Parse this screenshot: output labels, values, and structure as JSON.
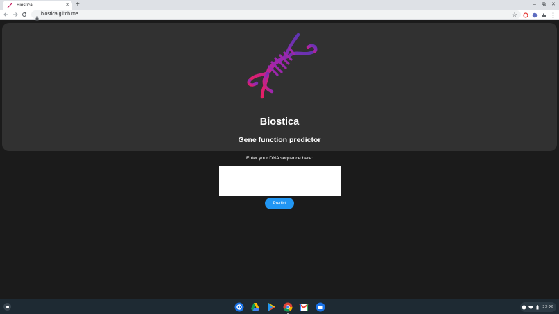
{
  "browser": {
    "tab": {
      "title": "Biostica",
      "close_glyph": "✕"
    },
    "new_tab_glyph": "+",
    "window_controls": {
      "minimize": "–",
      "restore": "⧉",
      "close": "✕"
    },
    "url": "biostica.glitch.me",
    "bookmark_glyph": "☆"
  },
  "page": {
    "logo_icon": "dna-helix-icon",
    "title": "Biostica",
    "subtitle": "Gene function predictor",
    "input_label": "Enter your DNA sequence here:",
    "input_value": "",
    "predict_button": "Predict",
    "colors": {
      "hero_bg": "#313131",
      "page_bg": "#1b1b1b",
      "button": "#2196f3",
      "dna_gradient": [
        "#e91e63",
        "#9c27b0",
        "#673ab7"
      ]
    }
  },
  "shelf": {
    "apps": [
      "settings-icon",
      "google-drive-icon",
      "play-store-icon",
      "chrome-icon",
      "gmail-icon",
      "files-icon"
    ],
    "clock": "22:29"
  }
}
